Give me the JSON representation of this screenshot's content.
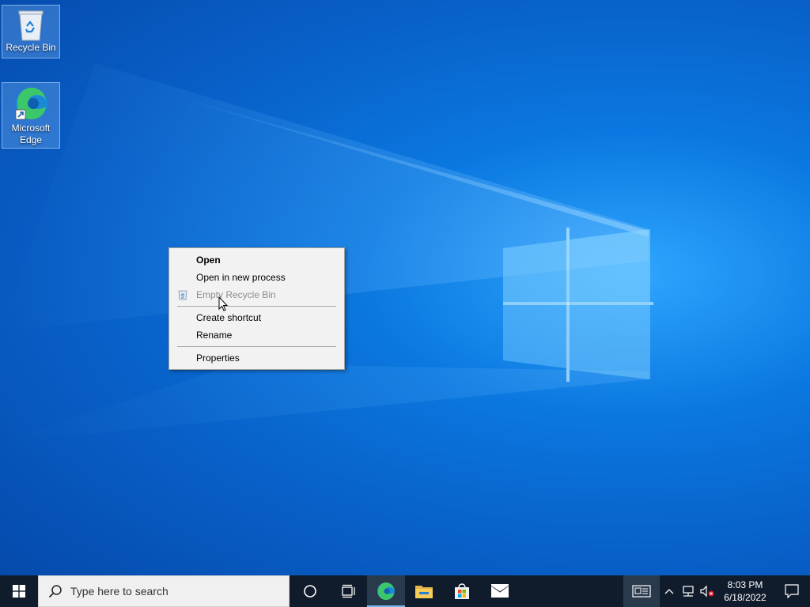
{
  "desktop": {
    "icons": [
      {
        "label": "Recycle Bin",
        "icon": "recycle-bin-icon"
      },
      {
        "label": "Microsoft\nEdge",
        "icon": "edge-icon"
      }
    ]
  },
  "context_menu": {
    "items": {
      "open": "Open",
      "open_new_process": "Open in new process",
      "empty_recycle_bin": "Empty Recycle Bin",
      "create_shortcut": "Create shortcut",
      "rename": "Rename",
      "properties": "Properties"
    }
  },
  "taskbar": {
    "search_placeholder": "Type here to search",
    "pinned": [
      "cortana-icon",
      "task-view-icon",
      "edge-icon",
      "file-explorer-icon",
      "store-icon",
      "mail-icon"
    ],
    "clock": {
      "time": "8:03 PM",
      "date": "6/18/2022"
    }
  },
  "colors": {
    "accent": "#0a78e0",
    "taskbar": "#101c2b",
    "menu_bg": "#f2f2f2"
  }
}
